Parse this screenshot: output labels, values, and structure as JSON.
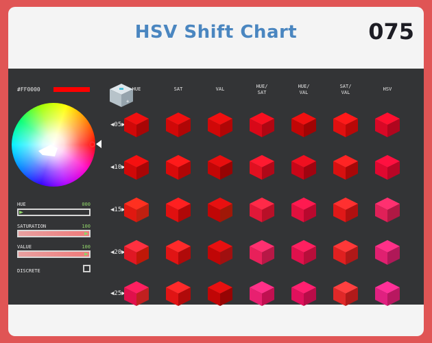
{
  "header": {
    "title": "HSV Shift Chart",
    "number": "075"
  },
  "picker": {
    "hex": "#FF0000",
    "swatch_color": "#ff0000",
    "sliders": [
      {
        "label": "HUE",
        "value": "000",
        "fill_fraction": 0.0
      },
      {
        "label": "SATURATION",
        "value": "100",
        "fill_fraction": 1.0
      },
      {
        "label": "VALUE",
        "value": "100",
        "fill_fraction": 1.0
      }
    ],
    "discrete_label": "DISCRETE",
    "discrete_checked": false
  },
  "grid": {
    "columns": [
      "HUE",
      "SAT",
      "VAL",
      "HUE/\nSAT",
      "HUE/\nVAL",
      "SAT/\nVAL",
      "HSV"
    ],
    "rows": [
      "05",
      "10",
      "15",
      "20",
      "25"
    ],
    "cells": [
      [
        [
          "#f01010",
          "#d00808",
          "#a80606"
        ],
        [
          "#f01010",
          "#d00808",
          "#b00606"
        ],
        [
          "#f01010",
          "#d00808",
          "#b00606"
        ],
        [
          "#f81020",
          "#d80818",
          "#b00612"
        ],
        [
          "#f01010",
          "#c00606",
          "#a00404"
        ],
        [
          "#ff1a1a",
          "#e01010",
          "#b80808"
        ],
        [
          "#ff1030",
          "#d80826",
          "#b0061e"
        ]
      ],
      [
        [
          "#f51010",
          "#d00808",
          "#a80606"
        ],
        [
          "#ff1a1a",
          "#d80a0a",
          "#b00606"
        ],
        [
          "#e80e0e",
          "#c20606",
          "#960404"
        ],
        [
          "#ff1a30",
          "#e01020",
          "#b00818"
        ],
        [
          "#f01020",
          "#c80618",
          "#a00410"
        ],
        [
          "#ff2424",
          "#d81010",
          "#a80808"
        ],
        [
          "#ff1040",
          "#e00830",
          "#b80626"
        ]
      ],
      [
        [
          "#ff3020",
          "#e01810",
          "#c02010"
        ],
        [
          "#ff2020",
          "#e01010",
          "#b00808"
        ],
        [
          "#e81010",
          "#c00606",
          "#a01808"
        ],
        [
          "#ff2a48",
          "#e01838",
          "#b81028"
        ],
        [
          "#ff1a50",
          "#e0103e",
          "#b8082e"
        ],
        [
          "#ff3030",
          "#e01818",
          "#b01010"
        ],
        [
          "#ff3070",
          "#e02058",
          "#b01844"
        ]
      ],
      [
        [
          "#ff3040",
          "#e01824",
          "#c01808"
        ],
        [
          "#ff2a2a",
          "#e01414",
          "#b00a0a"
        ],
        [
          "#e81010",
          "#c00606",
          "#a01010"
        ],
        [
          "#ff3070",
          "#e8205a",
          "#b81846"
        ],
        [
          "#ff2060",
          "#e0104c",
          "#b80e3a"
        ],
        [
          "#ff3838",
          "#e02020",
          "#b01818"
        ],
        [
          "#ff3088",
          "#e02070",
          "#b01858"
        ]
      ],
      [
        [
          "#ff2060",
          "#e0104c",
          "#c02020"
        ],
        [
          "#ff2a2a",
          "#e01414",
          "#b00a0a"
        ],
        [
          "#e81010",
          "#c00606",
          "#960404"
        ],
        [
          "#ff3088",
          "#e82070",
          "#c01050"
        ],
        [
          "#ff2070",
          "#e0105c",
          "#b80c48"
        ],
        [
          "#ff4040",
          "#e02828",
          "#b01a1a"
        ],
        [
          "#ff3098",
          "#e02080",
          "#b81860"
        ]
      ]
    ]
  }
}
